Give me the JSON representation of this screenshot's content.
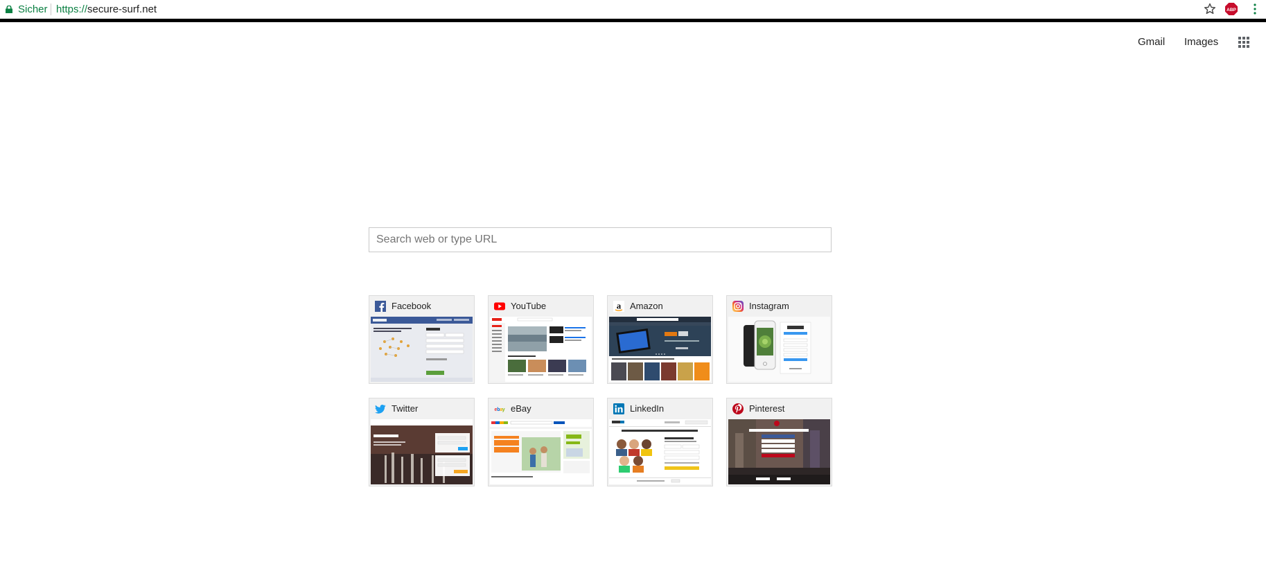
{
  "browser": {
    "secure_label": "Sicher",
    "url_scheme": "https://",
    "url_host": "secure-surf.net",
    "abp_label": "ABP"
  },
  "header": {
    "gmail": "Gmail",
    "images": "Images"
  },
  "search": {
    "placeholder": "Search web or type URL",
    "value": ""
  },
  "tiles": [
    {
      "label": "Facebook",
      "icon": "facebook-icon"
    },
    {
      "label": "YouTube",
      "icon": "youtube-icon"
    },
    {
      "label": "Amazon",
      "icon": "amazon-icon"
    },
    {
      "label": "Instagram",
      "icon": "instagram-icon"
    },
    {
      "label": "Twitter",
      "icon": "twitter-icon"
    },
    {
      "label": "eBay",
      "icon": "ebay-icon"
    },
    {
      "label": "LinkedIn",
      "icon": "linkedin-icon"
    },
    {
      "label": "Pinterest",
      "icon": "pinterest-icon"
    }
  ],
  "colors": {
    "secure_green": "#0b8043",
    "facebook": "#3b5998",
    "youtube": "#ff0000",
    "instagram": "#c13584",
    "twitter": "#1da1f2",
    "linkedin": "#0077b5",
    "pinterest": "#bd081c"
  }
}
